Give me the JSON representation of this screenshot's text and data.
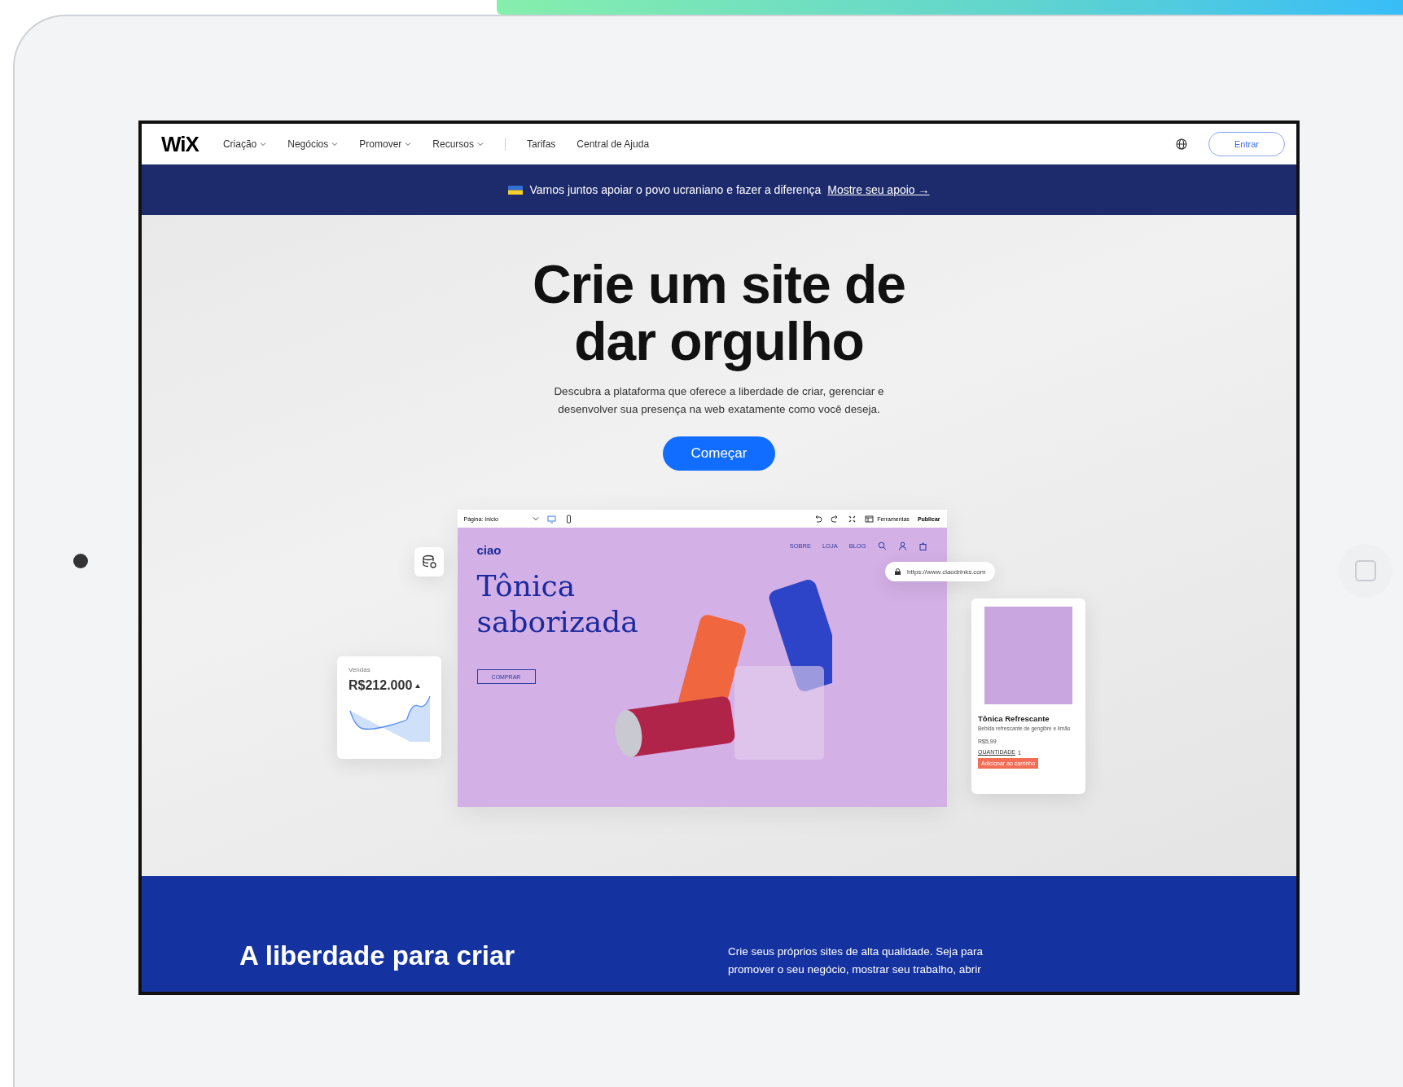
{
  "nav": {
    "logo": "WiX",
    "menus": [
      {
        "label": "Criação",
        "dropdown": true
      },
      {
        "label": "Negócios",
        "dropdown": true
      },
      {
        "label": "Promover",
        "dropdown": true
      },
      {
        "label": "Recursos",
        "dropdown": true
      }
    ],
    "links": [
      "Tarifas",
      "Central de Ajuda"
    ],
    "login": "Entrar"
  },
  "banner": {
    "text": "Vamos juntos apoiar o povo ucraniano e fazer a diferença",
    "link": "Mostre seu apoio",
    "arrow": "→"
  },
  "hero": {
    "title": "Crie um site de dar orgulho",
    "subtitle": "Descubra a plataforma que oferece a liberdade de criar, gerenciar e desenvolver sua presença na web exatamente como você deseja.",
    "cta": "Começar"
  },
  "editor": {
    "page_select": "Página: Início",
    "tools": "Ferramentas",
    "publish": "Publicar",
    "site": {
      "logo": "ciao",
      "menu": [
        "SOBRE",
        "LOJA",
        "BLOG"
      ],
      "headline": "Tônica saborizada",
      "button": "COMPRAR"
    }
  },
  "url": "https://www.ciaodrinks.com",
  "sales": {
    "label": "Vendas",
    "value": "R$212.000"
  },
  "product": {
    "name": "Tônica Refrescante",
    "description": "Bebida refrescante de gengibre e limão",
    "price": "R$5,99",
    "quantity_label": "QUANTIDADE",
    "quantity": "1",
    "add_button": "Adicionar ao carrinho"
  },
  "section": {
    "title": "A liberdade para criar",
    "text": "Crie seus próprios sites de alta qualidade. Seja para promover o seu negócio, mostrar seu trabalho, abrir"
  }
}
